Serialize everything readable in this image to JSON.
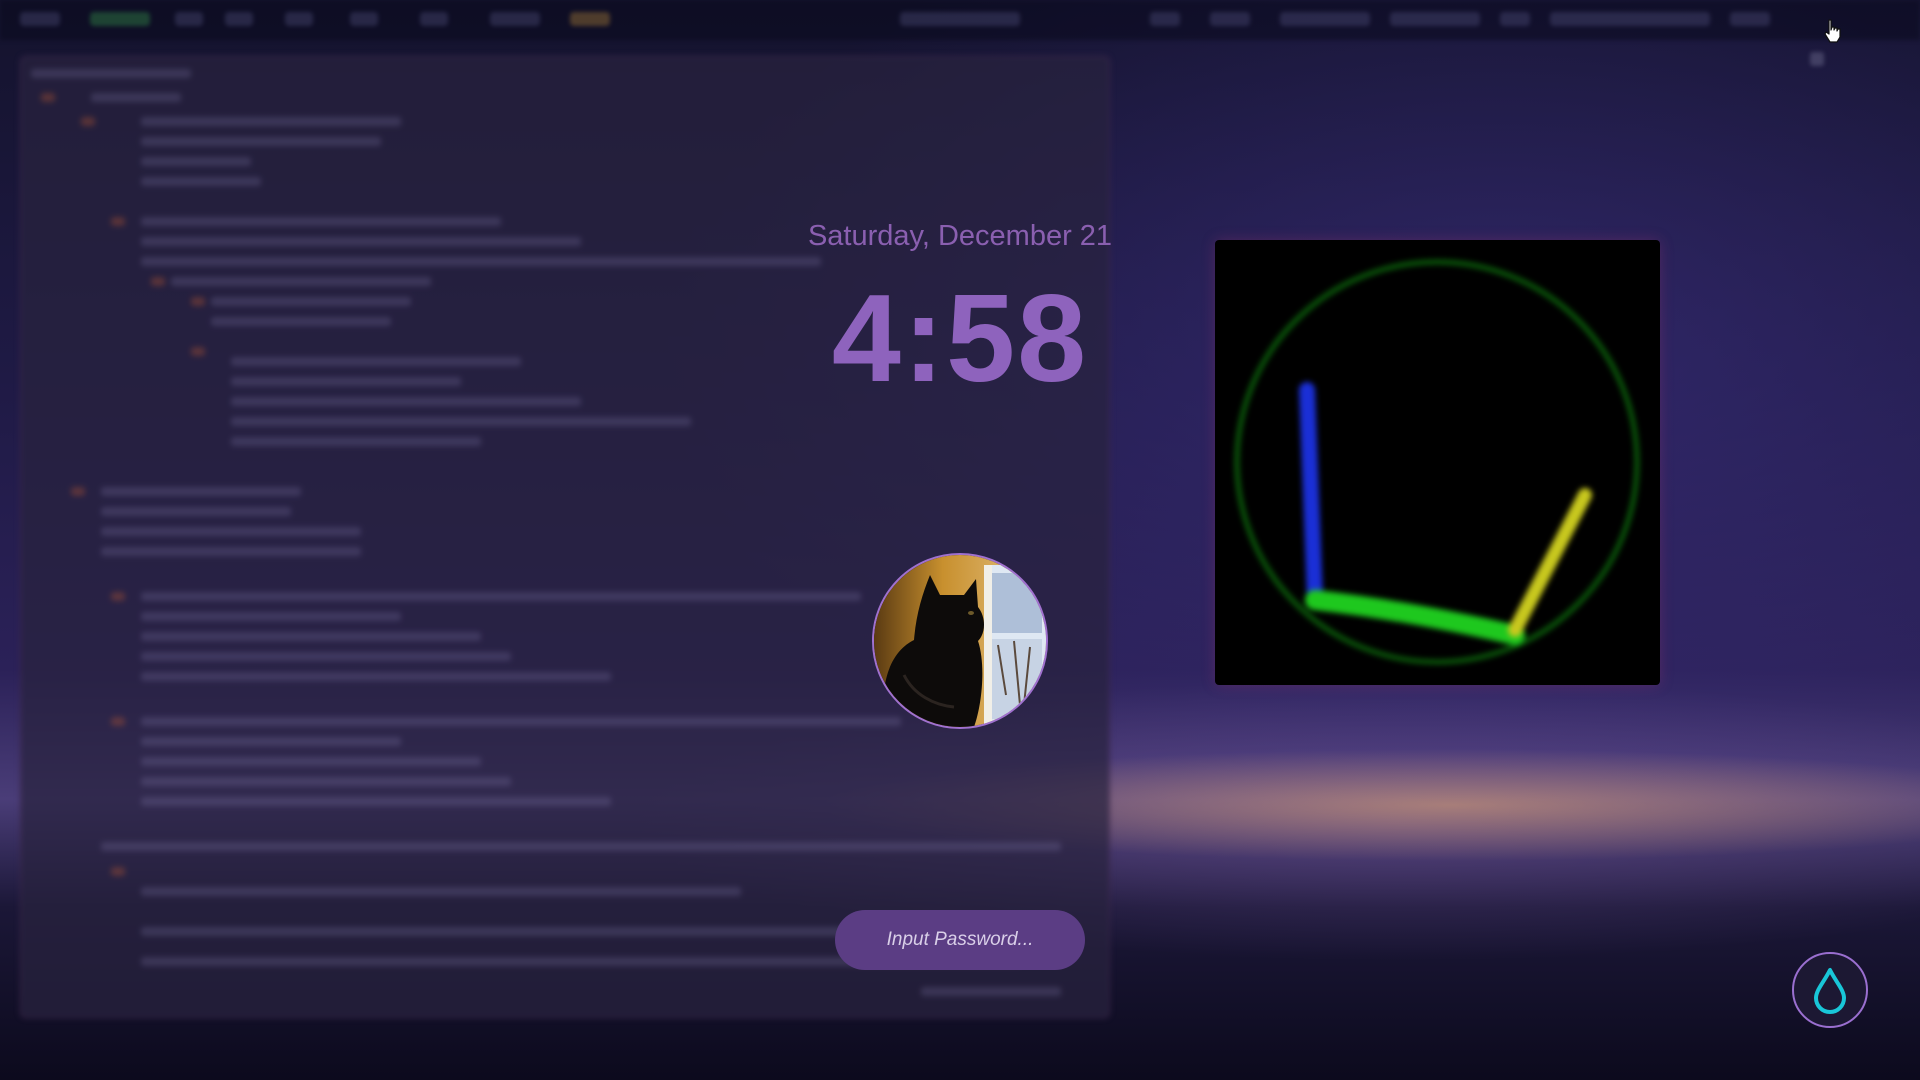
{
  "lockscreen": {
    "date": "Saturday, December 21",
    "time": "4:58",
    "password": {
      "placeholder": "Input Password...",
      "value": ""
    },
    "avatar_label": "cat",
    "action_icon": "droplet-icon"
  },
  "visualizer": {
    "colors": {
      "ring": "#0a5a0a",
      "blue": "#1a2fd6",
      "green": "#1ec81e",
      "yellow": "#c8c81e"
    }
  },
  "theme": {
    "accent": "#8e63bd",
    "field_bg": "#5b3d84",
    "cursor_icon": "hand-pointer-icon"
  }
}
